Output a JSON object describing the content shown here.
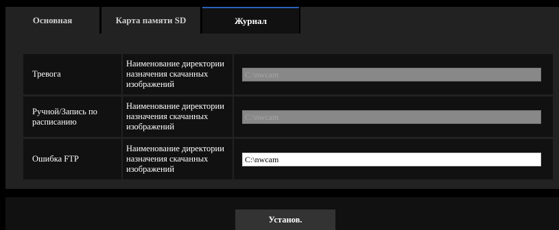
{
  "tabs": [
    {
      "label": "Основная",
      "active": false
    },
    {
      "label": "Карта памяти SD",
      "active": false
    },
    {
      "label": "Журнал",
      "active": true
    }
  ],
  "rows": [
    {
      "category": "Тревога",
      "label": "Наименование директории назначения скачанных изображений",
      "value": "C:\\nwcam",
      "enabled": false
    },
    {
      "category": "Ручной/Запись по расписанию",
      "label": "Наименование директории назначения скачанных изображений",
      "value": "C:\\nwcam",
      "enabled": false
    },
    {
      "category": "Ошибка FTP",
      "label": "Наименование директории назначения скачанных изображений",
      "value": "C:\\nwcam",
      "enabled": true
    }
  ],
  "actions": {
    "set_label": "Установ."
  },
  "colors": {
    "active_tab_accent": "#2a62b9",
    "panel_bg": "#222222",
    "cell_bg": "#111111",
    "disabled_input_bg": "#888888",
    "enabled_input_bg": "#ffffff"
  }
}
